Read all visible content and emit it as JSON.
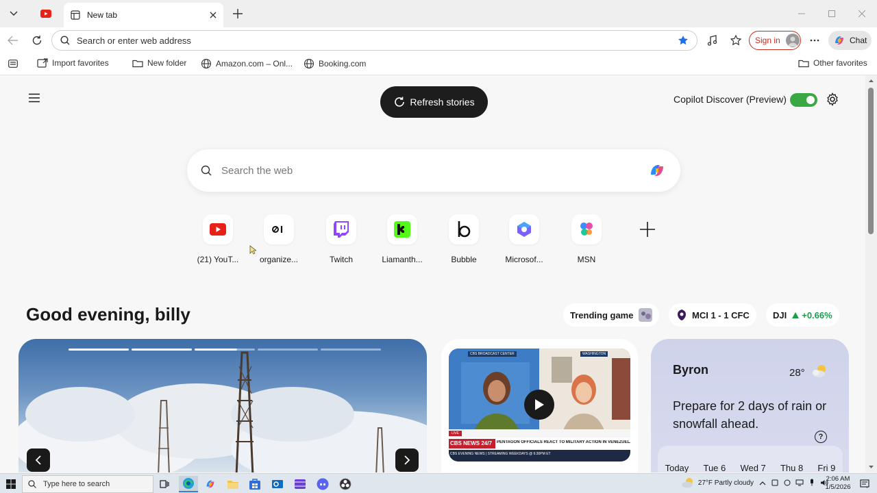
{
  "browser": {
    "tabs": [
      {
        "title": "New tab",
        "active": true
      }
    ],
    "address_placeholder": "Search or enter web address",
    "sign_in_label": "Sign in",
    "chat_label": "Chat"
  },
  "favorites": {
    "items": [
      {
        "label": "Import favorites",
        "icon": "import-icon"
      },
      {
        "label": "New folder",
        "icon": "folder-icon"
      },
      {
        "label": "Amazon.com – Onl...",
        "icon": "globe-icon"
      },
      {
        "label": "Booking.com",
        "icon": "globe-icon"
      }
    ],
    "other_label": "Other favorites"
  },
  "newtab": {
    "refresh_label": "Refresh stories",
    "copilot_label": "Copilot Discover (Preview)",
    "copilot_enabled": true,
    "search_placeholder": "Search the web",
    "tiles": [
      {
        "label": "(21) YouT...",
        "icon": "youtube-icon"
      },
      {
        "label": "organize...",
        "icon": "organize-icon"
      },
      {
        "label": "Twitch",
        "icon": "twitch-icon"
      },
      {
        "label": "Liamanth...",
        "icon": "kick-icon"
      },
      {
        "label": "Bubble",
        "icon": "bubble-icon"
      },
      {
        "label": "Microsof...",
        "icon": "microsoft-icon"
      },
      {
        "label": "MSN",
        "icon": "msn-icon"
      }
    ],
    "greeting": "Good evening, billy",
    "pills": {
      "trending": "Trending game",
      "score": "MCI 1 - 1 CFC",
      "stock_name": "DJI",
      "stock_change": "+0.66%"
    },
    "weather": {
      "city": "Byron",
      "temp": "28°",
      "message": "Prepare for 2 days of rain or snowfall ahead.",
      "help": "?",
      "days": [
        "Today",
        "Tue 6",
        "Wed 7",
        "Thu 8",
        "Fri 9"
      ]
    },
    "video": {
      "top_left": "CBS BROADCAST CENTER",
      "top_right": "WASHINGTON",
      "live": "LIVE",
      "network": "CBS NEWS 24/7",
      "headline": "PENTAGON OFFICIALS REACT TO MILITARY ACTION IN VENEZUELA",
      "ticker": "CBS EVENING NEWS | STREAMING WEEKDAYS @ 6:30PM ET"
    }
  },
  "taskbar": {
    "search_placeholder": "Type here to search",
    "weather": "27°F  Partly cloudy",
    "time": "2:06 AM",
    "date": "1/5/2026"
  }
}
